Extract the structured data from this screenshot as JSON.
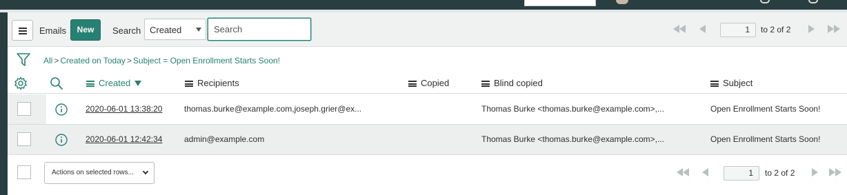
{
  "list": {
    "title": "Emails",
    "new_label": "New",
    "search_label": "Search",
    "search_field": "Created",
    "search_placeholder": "Search"
  },
  "pagination": {
    "current_page": "1",
    "range_text": "to 2 of 2"
  },
  "breadcrumb": {
    "items": [
      "All",
      "Created on Today",
      "Subject = Open Enrollment Starts Soon!"
    ],
    "separator": ">"
  },
  "columns": {
    "created": "Created",
    "recipients": "Recipients",
    "copied": "Copied",
    "blind_copied": "Blind copied",
    "subject": "Subject"
  },
  "rows": [
    {
      "created": "2020-06-01 13:38:20",
      "recipients": "thomas.burke@example.com,joseph.grier@ex...",
      "copied": "",
      "blind_copied": "Thomas Burke <thomas.burke@example.com>,...",
      "subject": "Open Enrollment Starts Soon!"
    },
    {
      "created": "2020-06-01 12:42:34",
      "recipients": "admin@example.com",
      "copied": "",
      "blind_copied": "Thomas Burke <thomas.burke@example.com>,...",
      "subject": "Open Enrollment Starts Soon!"
    }
  ],
  "footer": {
    "actions_label": "Actions on selected rows..."
  },
  "icons": {
    "menu": "hamburger-icon",
    "filter": "funnel-icon",
    "settings": "gear-icon",
    "search": "magnifier-icon",
    "info": "info-circle-icon"
  },
  "colors": {
    "accent": "#278172",
    "header_bg": "#293e40",
    "toolbar_bg": "#f0f2f2"
  }
}
